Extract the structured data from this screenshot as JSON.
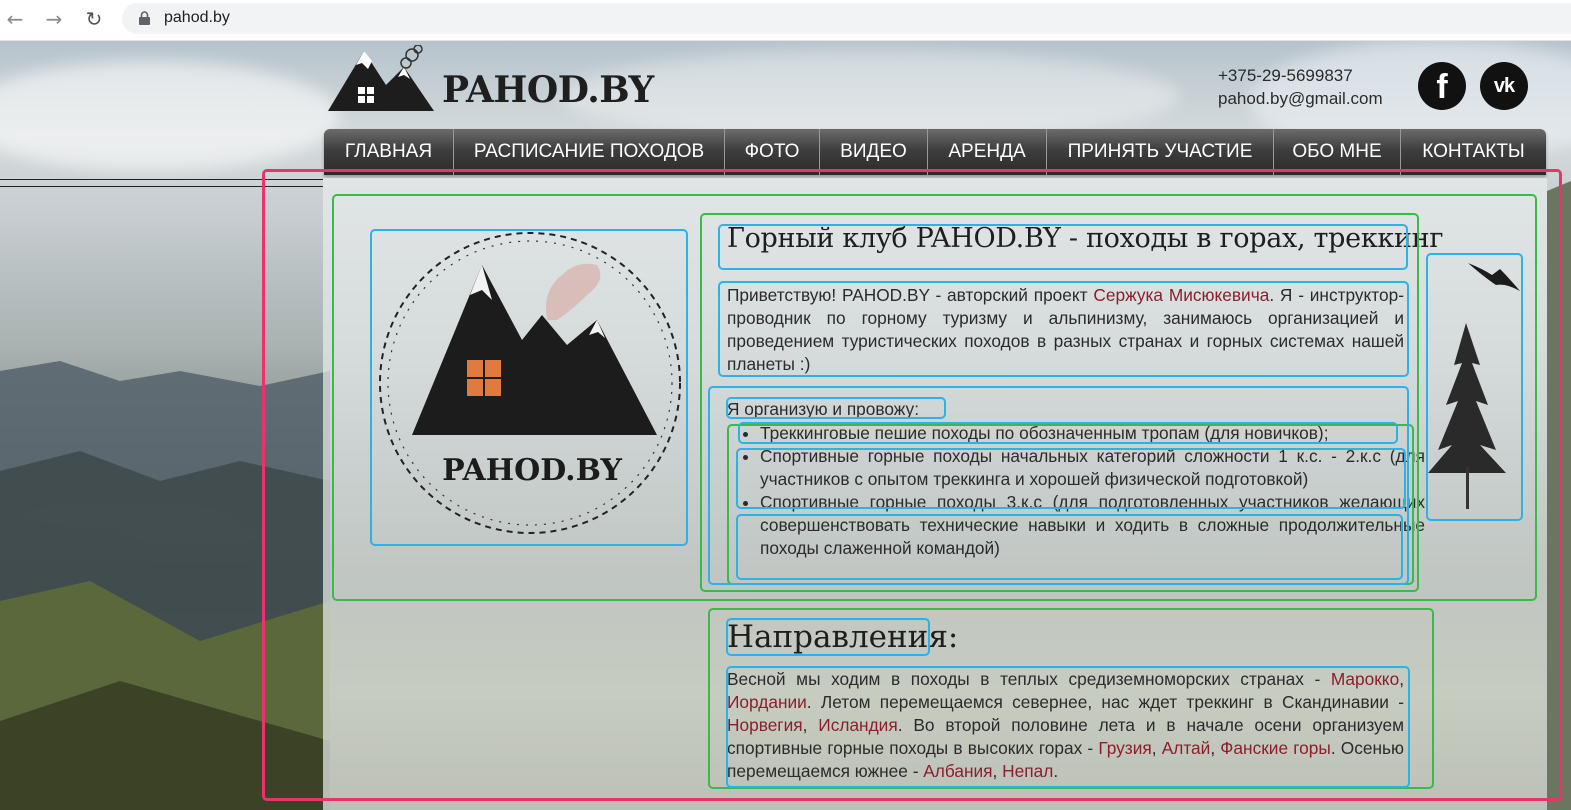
{
  "browser": {
    "back": "←",
    "forward": "→",
    "reload": "↻",
    "url": "pahod.by"
  },
  "header": {
    "logo_text": "PAHOD.BY",
    "phone": "+375-29-5699837",
    "email": "pahod.by@gmail.com",
    "social": [
      {
        "name": "facebook-icon",
        "glyph": "f"
      },
      {
        "name": "vk-icon",
        "glyph": "vk"
      }
    ]
  },
  "menu": {
    "items": [
      {
        "label": "ГЛАВНАЯ"
      },
      {
        "label": "РАСПИСАНИЕ ПОХОДОВ"
      },
      {
        "label": "ФОТО"
      },
      {
        "label": "ВИДЕО"
      },
      {
        "label": "АРЕНДА"
      },
      {
        "label": "ПРИНЯТЬ УЧАСТИЕ"
      },
      {
        "label": "ОБО МНЕ"
      },
      {
        "label": "КОНТАКТЫ"
      }
    ]
  },
  "main": {
    "emblem_text": "PAHOD.BY",
    "title": "Горный клуб PAHOD.BY - походы в горах, треккинг",
    "intro": {
      "part1": "Приветствую! PAHOD.BY - авторский проект ",
      "author_link": "Сержука Мисюкевича",
      "part2": ". Я - инструктор-проводник по горному туризму и альпинизму, занимаюсь организацией и проведением туристических походов в разных странах и горных системах нашей планеты :)"
    },
    "organize_label": "Я организую и провожу:",
    "list": [
      "Треккинговые пешие походы по обозначенным тропам (для новичков);",
      "Спортивные горные походы начальных категорий сложности 1 к.с. - 2.к.с (для участников с опытом треккинга и хорошей физической подготовкой)",
      "Спортивные горные походы 3.к.с (для подготовленных участников желающих совершенствовать технические навыки и ходить в сложные продолжительные походы слаженной командой)"
    ],
    "directions_title": "Направления:",
    "directions": {
      "t1": "Весной мы ходим в походы в теплых средиземноморских странах - ",
      "l1": "Марокко",
      "t2": ", ",
      "l2": "Иордании",
      "t3": ". Летом перемещаемся севернее, нас ждет треккинг в Скандинавии - ",
      "l3": "Норвегия",
      "t4": ", ",
      "l4": "Исландия",
      "t5": ". Во второй половине лета и в начале осени организуем спортивные горные походы в высоких горах - ",
      "l5": "Грузия",
      "t6": ", ",
      "l6": "Алтай",
      "t7": ", ",
      "l7": "Фанские горы",
      "t8": ". Осенью перемещаемся южнее - ",
      "l8": "Албания",
      "t9": ", ",
      "l9": "Непал",
      "t10": "."
    }
  }
}
